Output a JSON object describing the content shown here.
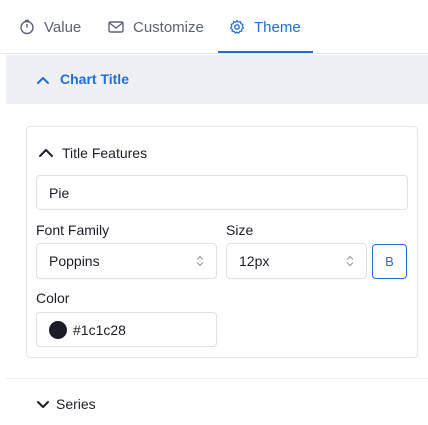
{
  "tabs": [
    {
      "label": "Value",
      "icon": "timer-icon"
    },
    {
      "label": "Customize",
      "icon": "envelope-icon"
    },
    {
      "label": "Theme",
      "icon": "gear-icon",
      "active": true
    }
  ],
  "section": {
    "title": "Chart Title",
    "expanded": true
  },
  "title_features": {
    "heading": "Title Features",
    "title_value": "Pie",
    "font_family_label": "Font Family",
    "font_family_value": "Poppins",
    "size_label": "Size",
    "size_value": "12px",
    "bold_label": "B",
    "color_label": "Color",
    "color_value": "#1c1c28"
  },
  "series_section": {
    "title": "Series",
    "expanded": false
  },
  "colors": {
    "accent": "#1f6fd6",
    "swatch": "#1c1c28"
  }
}
